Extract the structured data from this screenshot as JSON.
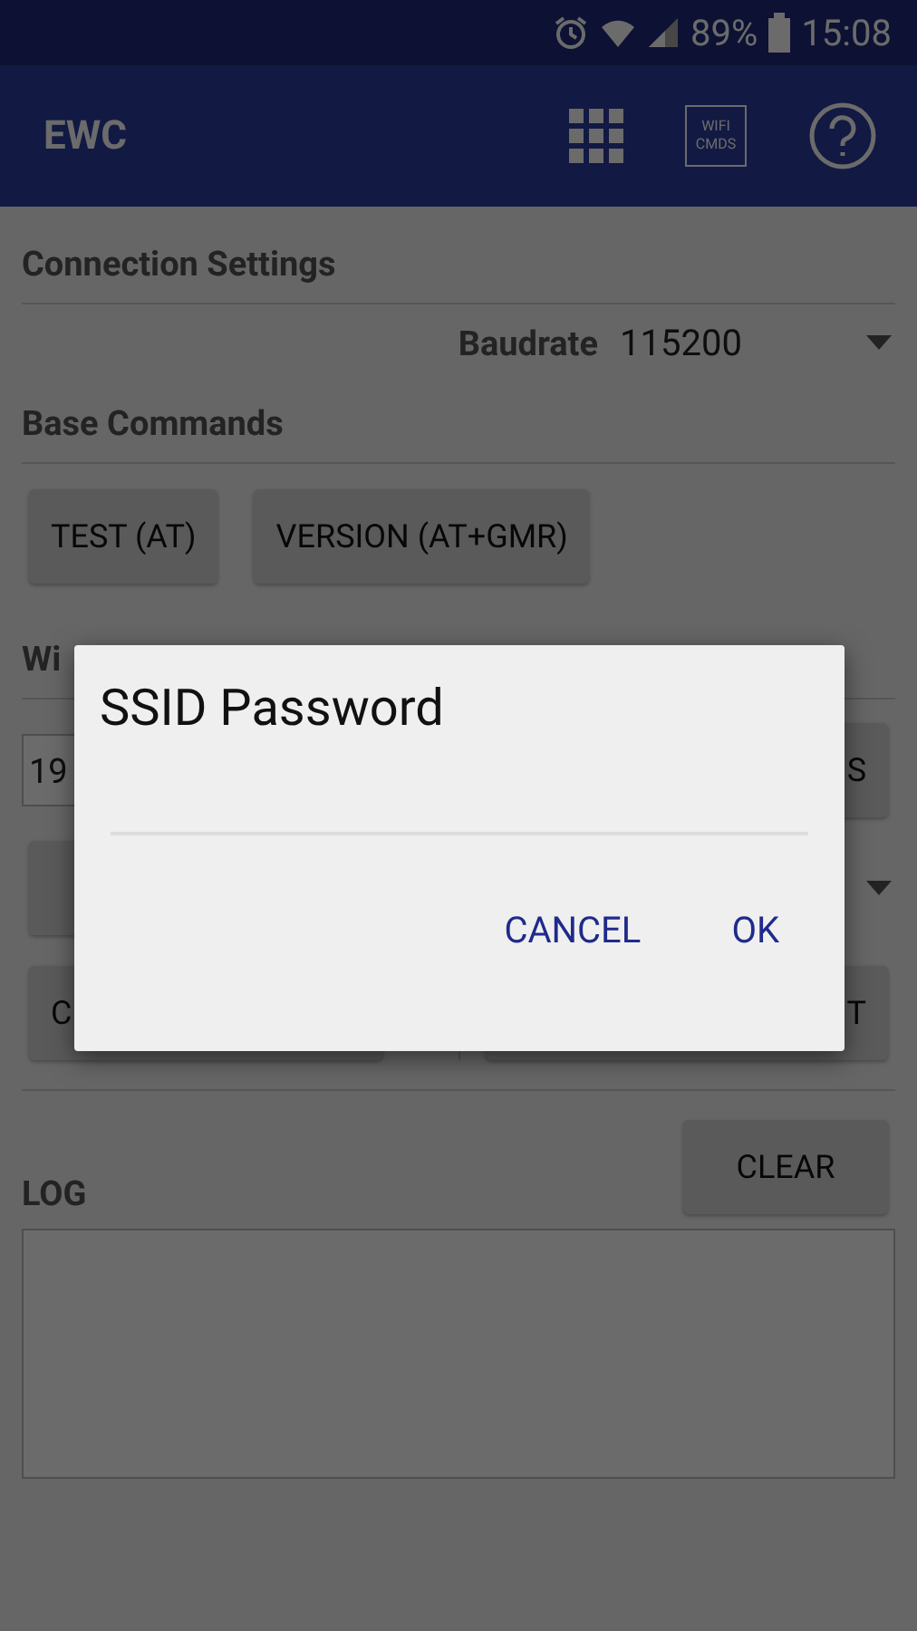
{
  "status_bar": {
    "battery": "89%",
    "time": "15:08"
  },
  "app_bar": {
    "title": "EWC",
    "wifi_cmds_icon_lines": [
      "WIFI",
      "CMDS"
    ]
  },
  "connection_settings": {
    "heading": "Connection Settings",
    "baudrate_label": "Baudrate",
    "baudrate_value": "115200"
  },
  "base_commands": {
    "heading": "Base Commands",
    "buttons": [
      "TEST (AT)",
      "VERSION (AT+GMR)"
    ]
  },
  "wifi_connection": {
    "heading": "Wi",
    "ip_field_value": "19",
    "row_1_button": "S",
    "row_3_left_button": "C",
    "row_3_right_button": "T"
  },
  "log": {
    "heading": "LOG",
    "clear_button": "CLEAR"
  },
  "dialog": {
    "title": "SSID Password",
    "buttons": [
      "CANCEL",
      "OK"
    ]
  }
}
